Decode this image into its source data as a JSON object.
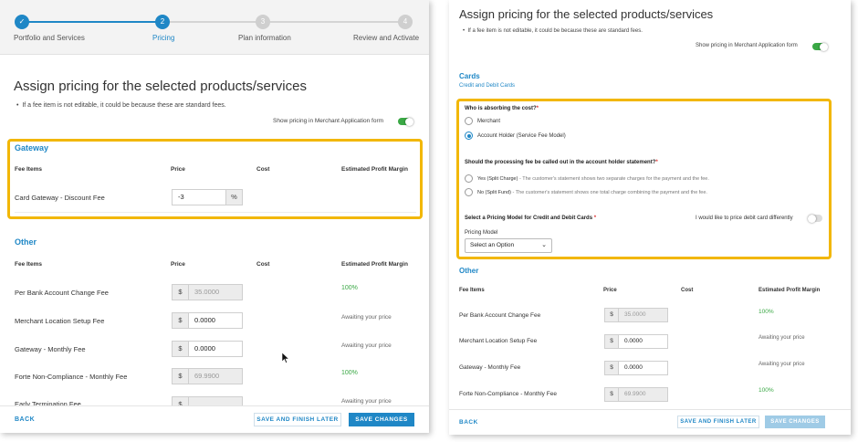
{
  "stepper": {
    "steps": [
      {
        "label": "Portfolio and Services",
        "number": "✓",
        "state": "done"
      },
      {
        "label": "Pricing",
        "number": "2",
        "state": "active"
      },
      {
        "label": "Plan information",
        "number": "3",
        "state": "todo"
      },
      {
        "label": "Review and Activate",
        "number": "4",
        "state": "todo"
      }
    ]
  },
  "left": {
    "title": "Assign pricing for the selected products/services",
    "note": "If a fee item is not editable, it could be because these are standard fees.",
    "show_pricing_label": "Show pricing in Merchant Application form",
    "columns": {
      "fee": "Fee Items",
      "price": "Price",
      "cost": "Cost",
      "margin": "Estimated Profit Margin"
    },
    "gateway": {
      "title": "Gateway",
      "rows": [
        {
          "label": "Card Gateway - Discount Fee",
          "value": "-3",
          "suffix": "%"
        }
      ]
    },
    "other": {
      "title": "Other",
      "rows": [
        {
          "label": "Per Bank Account Change Fee",
          "prefix": "$",
          "value": "35.0000",
          "disabled": true,
          "margin": "100%"
        },
        {
          "label": "Merchant Location Setup Fee",
          "prefix": "$",
          "value": "0.0000",
          "disabled": false,
          "margin": "Awaiting your price"
        },
        {
          "label": "Gateway - Monthly Fee",
          "prefix": "$",
          "value": "0.0000",
          "disabled": false,
          "margin": "Awaiting your price"
        },
        {
          "label": "Forte Non-Compliance - Monthly Fee",
          "prefix": "$",
          "value": "69.9900",
          "disabled": true,
          "margin": "100%"
        },
        {
          "label": "Early Termination Fee",
          "prefix": "$",
          "value": "",
          "disabled": true,
          "margin": "Awaiting your price"
        }
      ]
    },
    "footer": {
      "back": "BACK",
      "save_later": "SAVE AND FINISH LATER",
      "save": "SAVE CHANGES"
    }
  },
  "right": {
    "title": "Assign pricing for the selected products/services",
    "note": "If a fee item is not editable, it could be because these are standard fees.",
    "show_pricing_label": "Show pricing in Merchant Application form",
    "cards": {
      "title": "Cards",
      "subtitle": "Credit and Debit Cards",
      "who_question": "Who is absorbing the cost?",
      "required_mark": "*",
      "who_options": [
        {
          "label": "Merchant",
          "checked": false
        },
        {
          "label": "Account Holder (Service Fee Model)",
          "checked": true
        }
      ],
      "callout_question": "Should the processing fee be called out in the account holder statement?",
      "callout_options": [
        {
          "label": "Yes (Split Charge)",
          "desc": " - The customer's statement shows two separate charges for the payment and the fee."
        },
        {
          "label": "No (Split Fund)",
          "desc": " - The customer's statement shows one total charge combining the payment and the fee."
        }
      ],
      "model_question": "Select a Pricing Model for Credit and Debit Cards",
      "debit_toggle_label": "I would like to price debit card differently",
      "model_label": "Pricing Model",
      "model_value": "Select an Option"
    },
    "columns": {
      "fee": "Fee Items",
      "price": "Price",
      "cost": "Cost",
      "margin": "Estimated Profit Margin"
    },
    "other": {
      "title": "Other",
      "rows": [
        {
          "label": "Per Bank Account Change Fee",
          "prefix": "$",
          "value": "35.0000",
          "disabled": true,
          "margin": "100%"
        },
        {
          "label": "Merchant Location Setup Fee",
          "prefix": "$",
          "value": "0.0000",
          "disabled": false,
          "margin": "Awaiting your price"
        },
        {
          "label": "Gateway - Monthly Fee",
          "prefix": "$",
          "value": "0.0000",
          "disabled": false,
          "margin": "Awaiting your price"
        },
        {
          "label": "Forte Non-Compliance - Monthly Fee",
          "prefix": "$",
          "value": "69.9900",
          "disabled": true,
          "margin": "100%"
        }
      ]
    },
    "footer": {
      "back": "BACK",
      "save_later": "SAVE AND FINISH LATER",
      "save": "SAVE CHANGES"
    }
  },
  "colors": {
    "accent": "#1f87c6",
    "highlight": "#f2b705",
    "toggle_on": "#3aa845",
    "margin_green": "#3aa845"
  }
}
